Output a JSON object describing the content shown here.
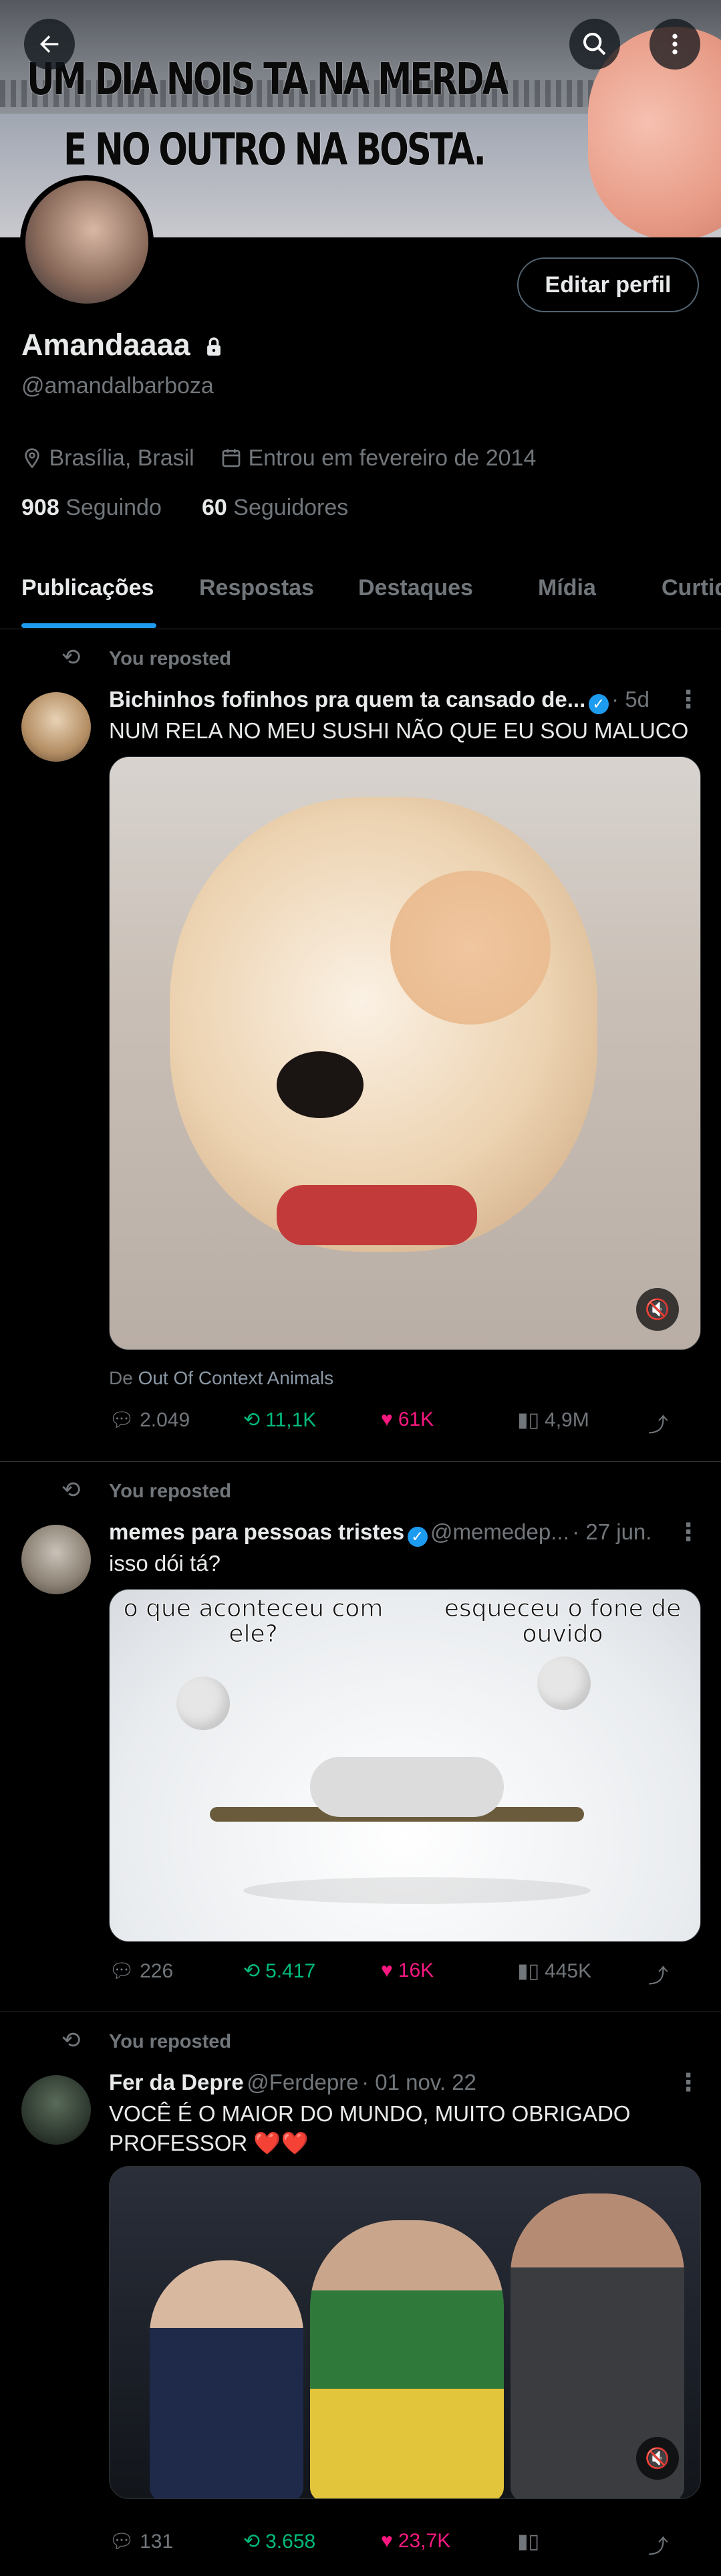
{
  "banner": {
    "line1": "UM DIA NOIS TA NA MERDA",
    "line2": "E NO OUTRO NA BOSTA."
  },
  "profile": {
    "name": "Amandaaaa",
    "handle": "@amandalbarboza",
    "location": "Brasília, Brasil",
    "joined": "Entrou em fevereiro de 2014",
    "following_count": "908",
    "following_label": "Seguindo",
    "followers_count": "60",
    "followers_label": "Seguidores",
    "edit_label": "Editar perfil"
  },
  "tabs": [
    {
      "label": "Publicações"
    },
    {
      "label": "Respostas"
    },
    {
      "label": "Destaques"
    },
    {
      "label": "Mídia"
    },
    {
      "label": "Curtidas"
    }
  ],
  "posts": [
    {
      "repost_label": "You reposted",
      "author": "Bichinhos fofinhos pra quem ta cansado de...",
      "handle": "",
      "time": "· 5d",
      "text": "NUM RELA NO MEU SUSHI NÃO QUE EU SOU MALUCO",
      "source_prefix": "De",
      "source": "Out Of Context Animals",
      "replies": "2.049",
      "reposts": "11,1K",
      "likes": "61K",
      "views": "4,9M"
    },
    {
      "repost_label": "You reposted",
      "author": "memes para pessoas tristes",
      "handle": "@memedep...",
      "time": "· 27 jun.",
      "text": "isso dói tá?",
      "caption_left": "o que aconteceu com ele?",
      "caption_right": "esqueceu o fone de ouvido",
      "replies": "226",
      "reposts": "5.417",
      "likes": "16K",
      "views": "445K"
    },
    {
      "repost_label": "You reposted",
      "author": "Fer da Depre",
      "handle": "@Ferdepre",
      "time": "· 01 nov. 22",
      "text": "VOCÊ É O MAIOR DO MUNDO, MUITO OBRIGADO PROFESSOR ❤️❤️",
      "replies": "131",
      "reposts": "3.658",
      "likes": "23,7K",
      "views": ""
    }
  ],
  "colors": {
    "accent": "#1d9bf0",
    "repost": "#00ba7c",
    "like": "#f91880",
    "muted": "#71767b"
  }
}
